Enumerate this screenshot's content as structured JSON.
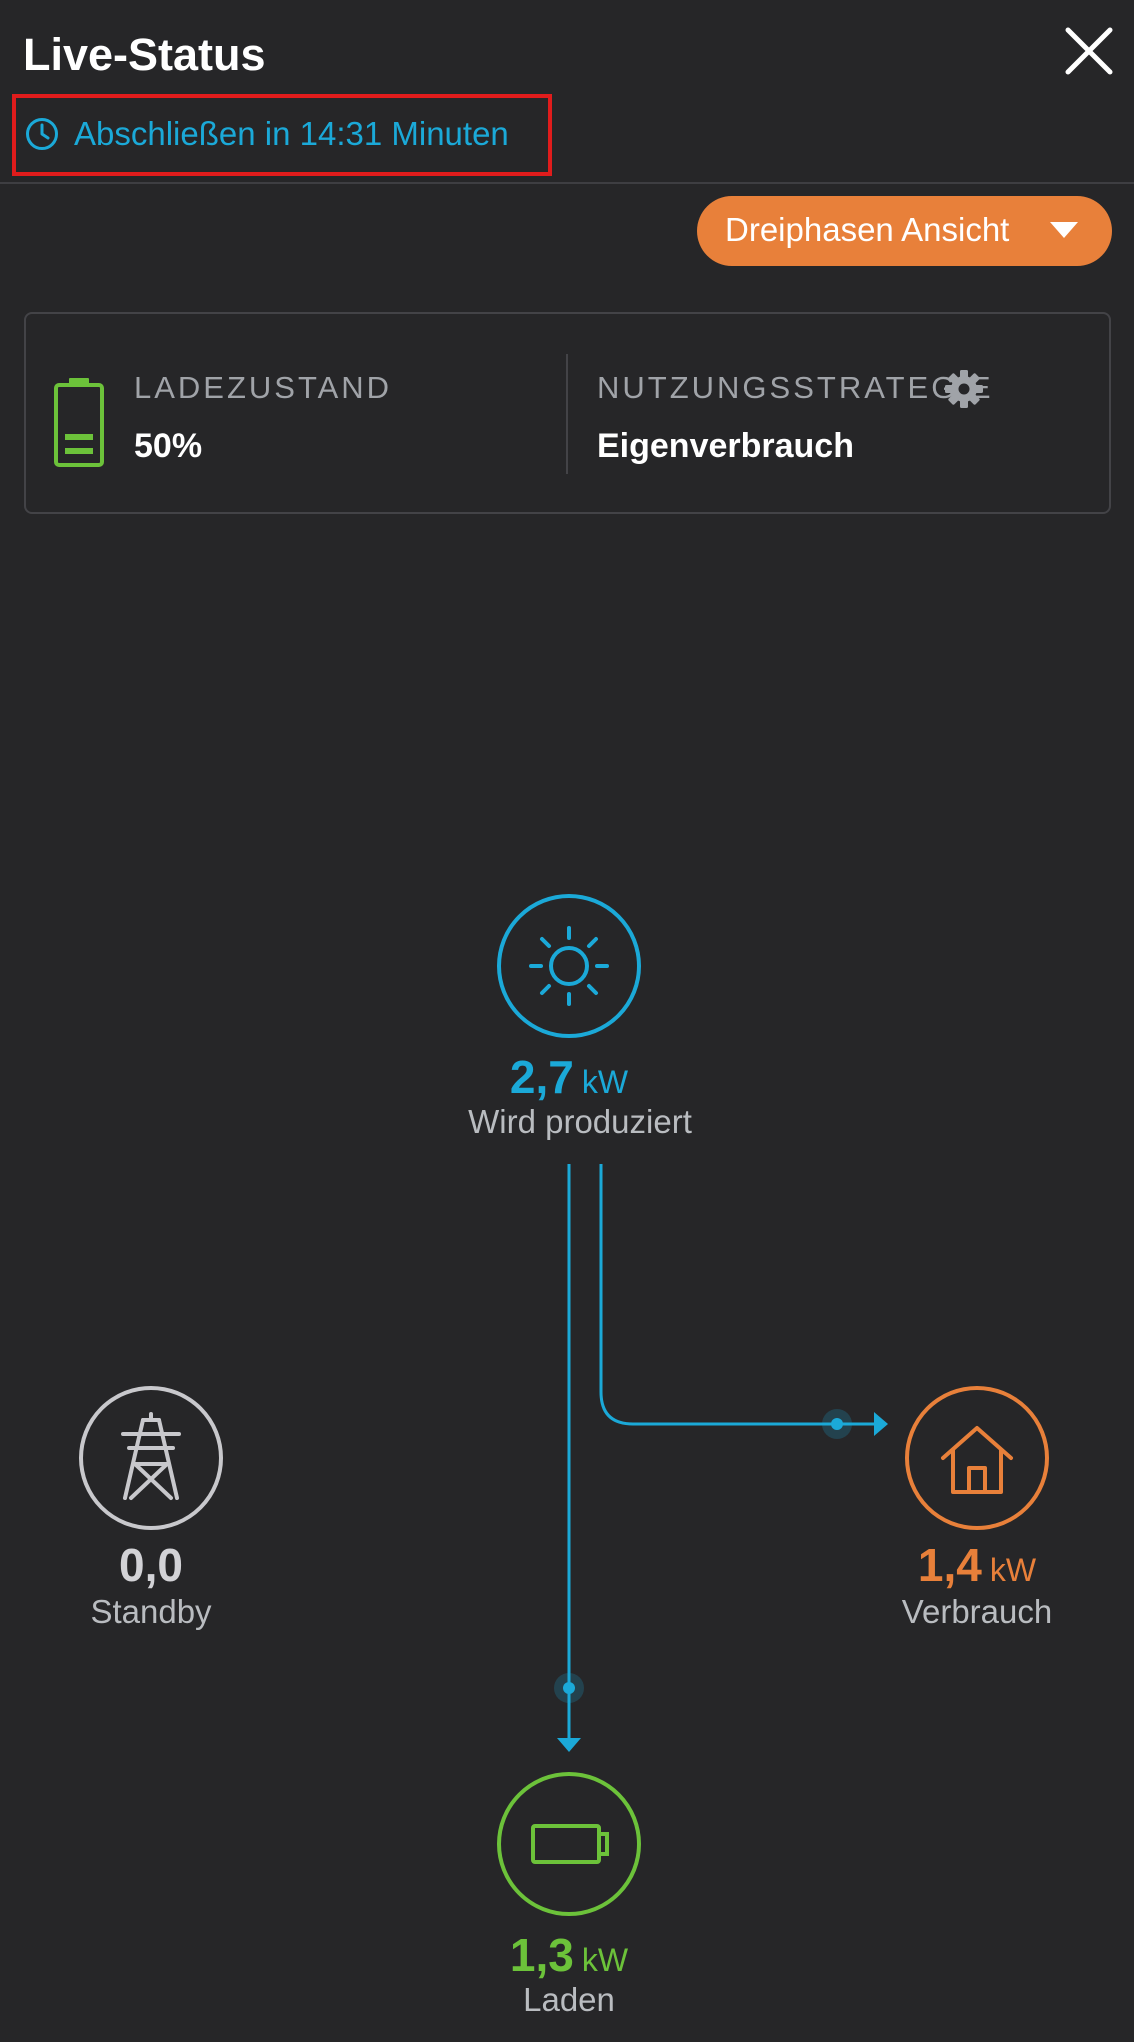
{
  "header": {
    "title": "Live-Status",
    "timer_text": "Abschließen in 14:31 Minuten",
    "close_icon": "close-icon",
    "timer_icon": "clock-icon"
  },
  "phase_view": {
    "label": "Dreiphasen Ansicht",
    "icon": "caret-down-icon"
  },
  "status_card": {
    "soc_label": "LADEZUSTAND",
    "soc_value": "50%",
    "soc_fraction": 0.5,
    "strategy_label": "NUTZUNGSSTRATEGIE",
    "strategy_value": "Eigenverbrauch",
    "battery_icon": "battery-icon",
    "settings_icon": "gear-icon"
  },
  "flow": {
    "solar": {
      "value": "2,7",
      "unit": "kW",
      "label": "Wird produziert",
      "icon": "sun-icon"
    },
    "grid": {
      "value": "0,0",
      "unit": "",
      "label": "Standby",
      "icon": "power-tower-icon"
    },
    "house": {
      "value": "1,4",
      "unit": "kW",
      "label": "Verbrauch",
      "icon": "house-icon"
    },
    "battery": {
      "value": "1,3",
      "unit": "kW",
      "label": "Laden",
      "icon": "battery-icon"
    }
  },
  "colors": {
    "background": "#262628",
    "solar": "#1ba9d8",
    "house": "#e8803a",
    "battery": "#6cc23a",
    "grid": "#c8c8cc",
    "accent_button": "#e8803a",
    "highlight_box": "#e01c1c"
  }
}
